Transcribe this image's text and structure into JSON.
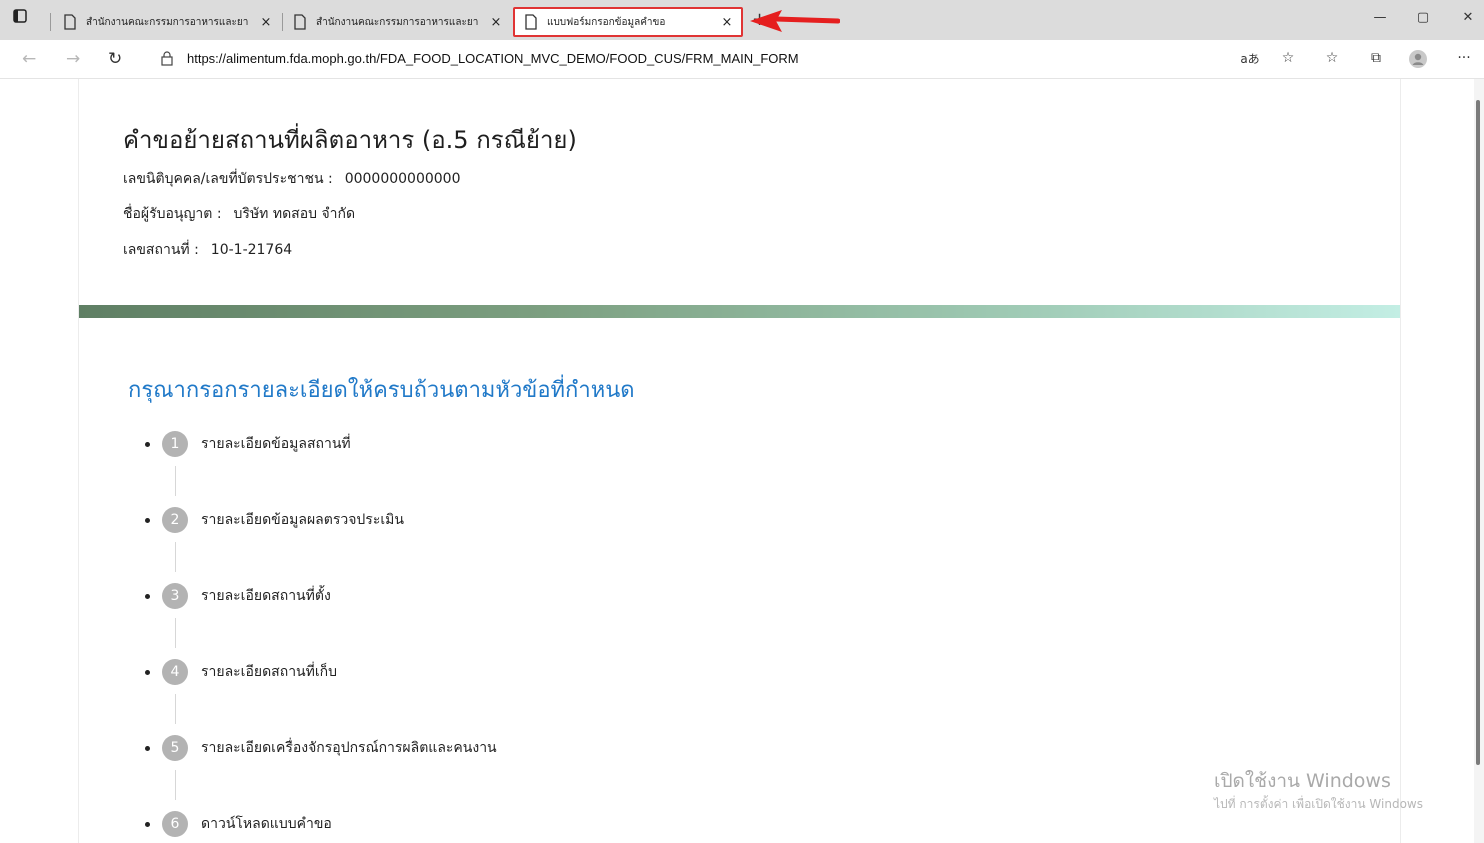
{
  "browser": {
    "tabs": [
      {
        "title": "สำนักงานคณะกรรมการอาหารและยา",
        "close": "×",
        "active": false
      },
      {
        "title": "สำนักงานคณะกรรมการอาหารและยา",
        "close": "×",
        "active": false
      },
      {
        "title": "แบบฟอร์มกรอกข้อมูลคำขอ",
        "close": "×",
        "active": true
      }
    ],
    "new_tab_symbol": "+",
    "url": "https://alimentum.fda.moph.go.th/FDA_FOOD_LOCATION_MVC_DEMO/FOOD_CUS/FRM_MAIN_FORM",
    "read_aloud_label": "aあ",
    "window_controls": {
      "minimize": "—",
      "maximize": "▢",
      "close": "✕"
    },
    "highlight_color": "#e03434"
  },
  "header": {
    "title": "คำขอย้ายสถานที่ผลิตอาหาร (อ.5 กรณีย้าย)",
    "fields": [
      {
        "label": "เลขนิติบุคคล/เลขที่บัตรประชาชน :",
        "value": "0000000000000"
      },
      {
        "label": "ชื่อผู้รับอนุญาต :",
        "value": "บริษัท ทดสอบ จำกัด"
      },
      {
        "label": "เลขสถานที่ :",
        "value": "10-1-21764"
      }
    ]
  },
  "instruction": "กรุณากรอกรายละเอียดให้ครบถ้วนตามหัวข้อที่กำหนด",
  "steps": [
    {
      "number": "1",
      "label": "รายละเอียดข้อมูลสถานที่"
    },
    {
      "number": "2",
      "label": "รายละเอียดข้อมูลผลตรวจประเมิน"
    },
    {
      "number": "3",
      "label": "รายละเอียดสถานที่ตั้ง"
    },
    {
      "number": "4",
      "label": "รายละเอียดสถานที่เก็บ"
    },
    {
      "number": "5",
      "label": "รายละเอียดเครื่องจักรอุปกรณ์การผลิตและคนงาน"
    },
    {
      "number": "6",
      "label": "ดาวน์โหลดแบบคำขอ"
    }
  ],
  "watermark": {
    "line1": "เปิดใช้งาน Windows",
    "line2": "ไปที่ การตั้งค่า เพื่อเปิดใช้งาน Windows"
  }
}
